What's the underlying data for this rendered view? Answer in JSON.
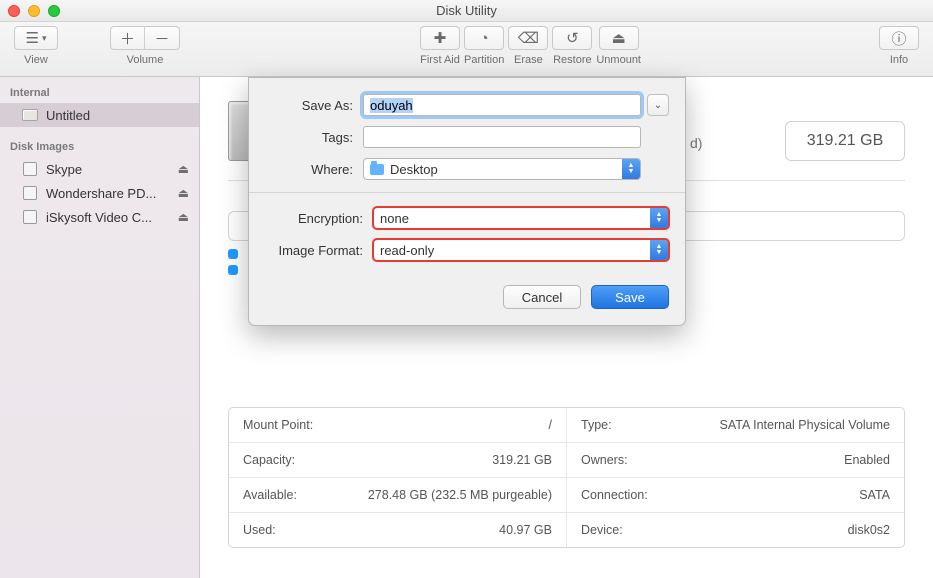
{
  "window": {
    "title": "Disk Utility"
  },
  "toolbar": {
    "view": "View",
    "volume": "Volume",
    "center": [
      {
        "label": "First Aid"
      },
      {
        "label": "Partition"
      },
      {
        "label": "Erase"
      },
      {
        "label": "Restore"
      },
      {
        "label": "Unmount"
      }
    ],
    "info": "Info"
  },
  "sidebar": {
    "internal_head": "Internal",
    "internal": [
      {
        "label": "Untitled"
      }
    ],
    "images_head": "Disk Images",
    "images": [
      {
        "label": "Skype"
      },
      {
        "label": "Wondershare PD..."
      },
      {
        "label": "iSkysoft Video C..."
      }
    ]
  },
  "main": {
    "capacity": "319.21 GB",
    "trail_text": "d)"
  },
  "dialog": {
    "save_as_label": "Save As:",
    "save_as_value": "oduyah",
    "tags_label": "Tags:",
    "where_label": "Where:",
    "where_value": "Desktop",
    "encryption_label": "Encryption:",
    "encryption_value": "none",
    "format_label": "Image Format:",
    "format_value": "read-only",
    "cancel": "Cancel",
    "save": "Save"
  },
  "info": {
    "mount_label": "Mount Point:",
    "mount_value": "/",
    "type_label": "Type:",
    "type_value": "SATA Internal Physical Volume",
    "capacity_label": "Capacity:",
    "capacity_value": "319.21 GB",
    "owners_label": "Owners:",
    "owners_value": "Enabled",
    "available_label": "Available:",
    "available_value": "278.48 GB (232.5 MB purgeable)",
    "connection_label": "Connection:",
    "connection_value": "SATA",
    "used_label": "Used:",
    "used_value": "40.97 GB",
    "device_label": "Device:",
    "device_value": "disk0s2"
  }
}
